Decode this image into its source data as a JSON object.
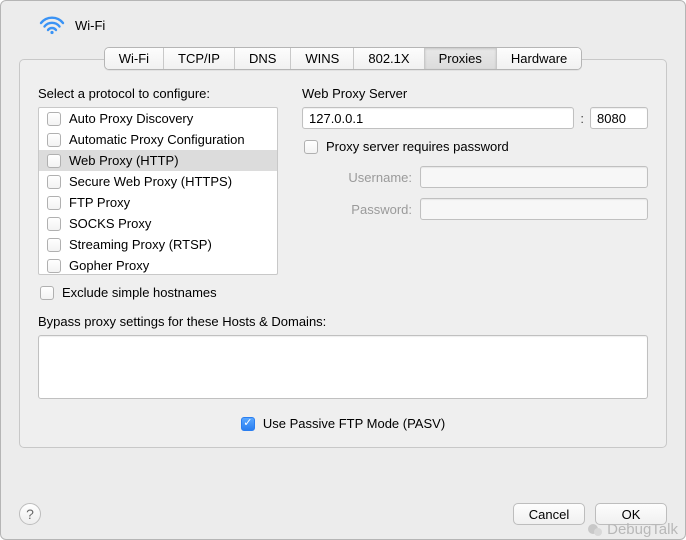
{
  "header": {
    "title": "Wi-Fi"
  },
  "tabs": [
    {
      "label": "Wi-Fi"
    },
    {
      "label": "TCP/IP"
    },
    {
      "label": "DNS"
    },
    {
      "label": "WINS"
    },
    {
      "label": "802.1X"
    },
    {
      "label": "Proxies"
    },
    {
      "label": "Hardware"
    }
  ],
  "left": {
    "title": "Select a protocol to configure:",
    "protocols": [
      {
        "label": "Auto Proxy Discovery"
      },
      {
        "label": "Automatic Proxy Configuration"
      },
      {
        "label": "Web Proxy (HTTP)"
      },
      {
        "label": "Secure Web Proxy (HTTPS)"
      },
      {
        "label": "FTP Proxy"
      },
      {
        "label": "SOCKS Proxy"
      },
      {
        "label": "Streaming Proxy (RTSP)"
      },
      {
        "label": "Gopher Proxy"
      }
    ],
    "exclude_label": "Exclude simple hostnames"
  },
  "right": {
    "title": "Web Proxy Server",
    "host": "127.0.0.1",
    "colon": ":",
    "port": "8080",
    "require_pw_label": "Proxy server requires password",
    "username_label": "Username:",
    "password_label": "Password:"
  },
  "bypass": {
    "label": "Bypass proxy settings for these Hosts & Domains:",
    "value": ""
  },
  "pasv": {
    "label": "Use Passive FTP Mode (PASV)"
  },
  "footer": {
    "help": "?",
    "cancel": "Cancel",
    "ok": "OK"
  },
  "watermark": "DebugTalk"
}
